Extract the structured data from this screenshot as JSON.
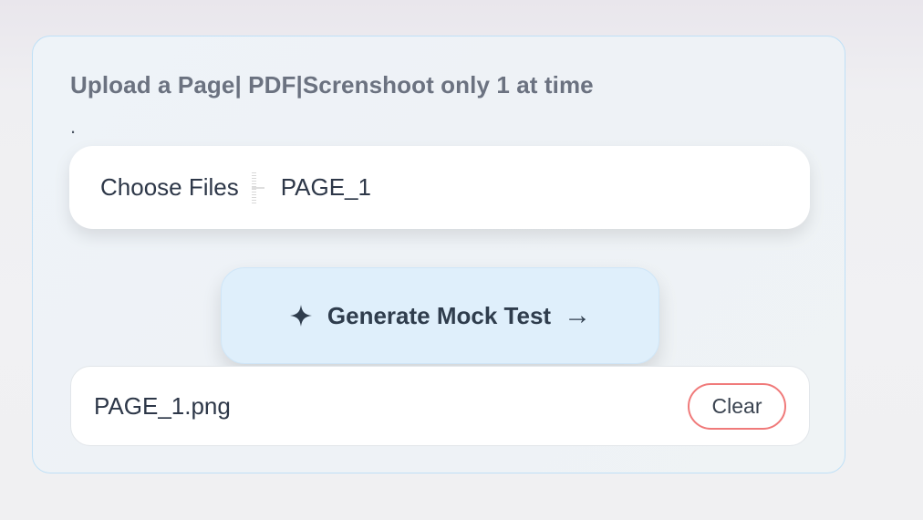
{
  "upload": {
    "title": "Upload a Page| PDF|Screnshoot only 1 at time",
    "dot": "."
  },
  "file_picker": {
    "button_label": "Choose Files",
    "selected_file": "PAGE_1"
  },
  "generate": {
    "label": "Generate Mock Test",
    "arrow": "→",
    "icon": "sparkle-icon"
  },
  "file_list": {
    "items": [
      {
        "name": "PAGE_1.png",
        "clear_label": "Clear"
      }
    ]
  },
  "colors": {
    "card_border": "#bfe0f7",
    "generate_bg": "#dfeffb",
    "clear_border": "#f07a7a",
    "title_text": "#6b7280"
  }
}
